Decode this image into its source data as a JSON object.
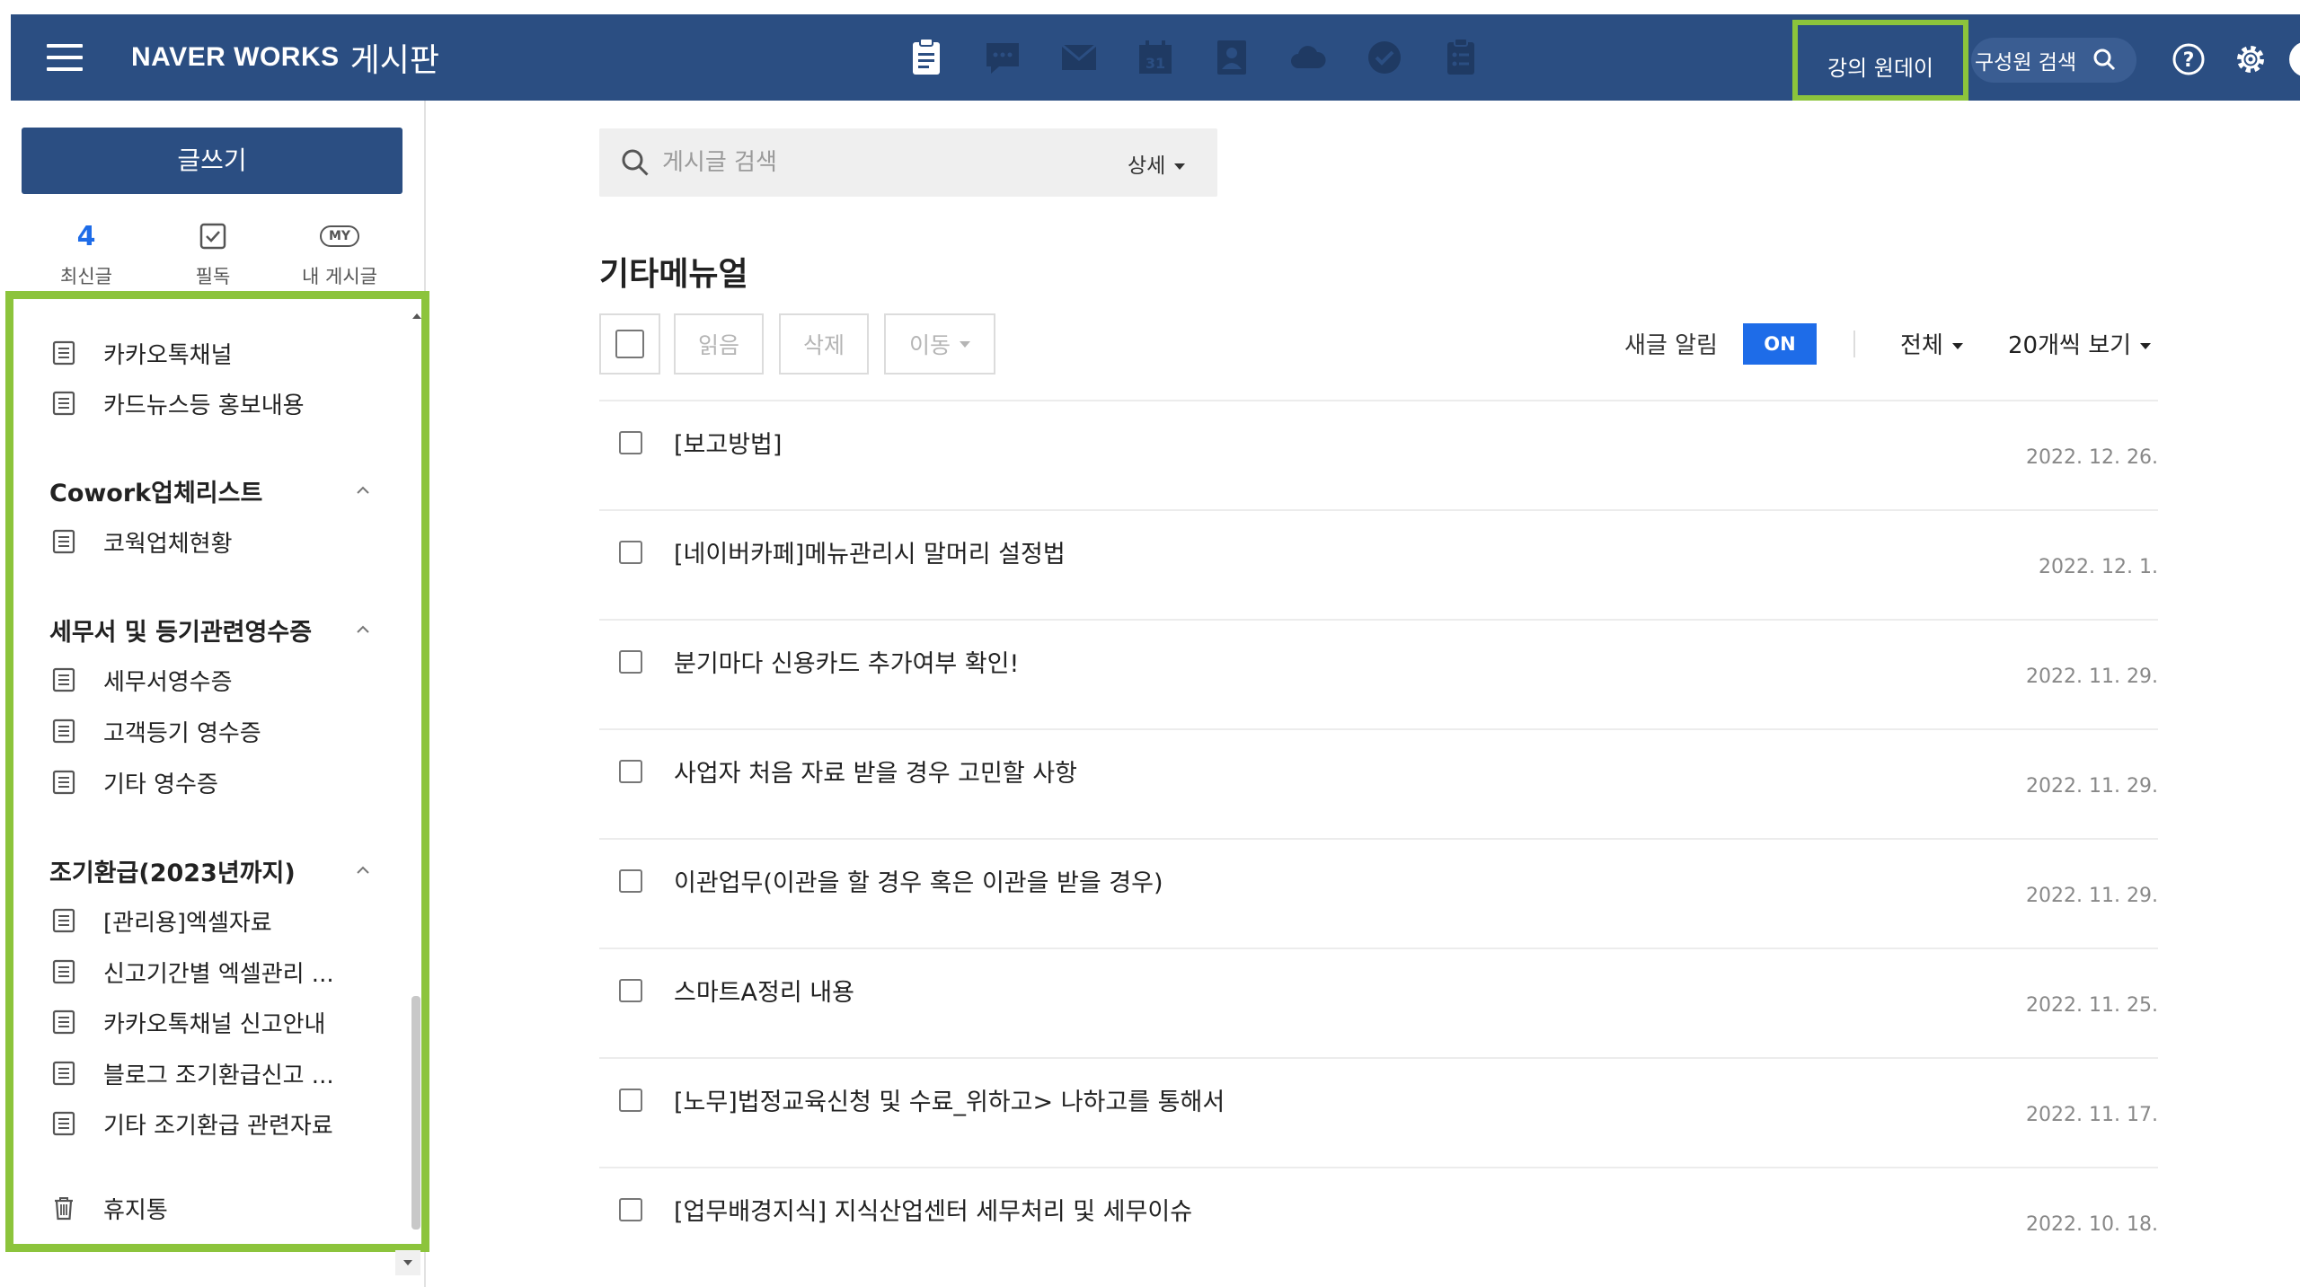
{
  "header": {
    "logo_text": "NAVER WORKS",
    "service_name": "게시판",
    "app_icons": [
      "board-icon",
      "message-icon",
      "mail-icon",
      "calendar-icon",
      "contacts-icon",
      "drive-icon",
      "task-icon",
      "form-icon"
    ],
    "calendar_day": "31",
    "highlight_label": "강의 원데이",
    "member_search_label": "구성원 검색",
    "colors": {
      "bar": "#2b4e82",
      "highlight": "#8cc43c",
      "accent": "#1e6ce8"
    }
  },
  "sidebar": {
    "write_button": "글쓰기",
    "quick_links": [
      {
        "value": "4",
        "label": "최신글"
      },
      {
        "icon": "check-square-icon",
        "label": "필독"
      },
      {
        "badge": "MY",
        "label": "내 게시글"
      }
    ],
    "tree": {
      "kakao_channel": "카카오톡채널",
      "card_news": "카드뉴스등 홍보내용",
      "group_cowork": "Cowork업체리스트",
      "cowork_status": "코웍업체현황",
      "group_tax": "세무서 및 등기관련영수증",
      "tax_office_receipt": "세무서영수증",
      "customer_registry_receipt": "고객등기 영수증",
      "other_receipt": "기타 영수증",
      "group_refund": "조기환급(2023년까지)",
      "admin_excel": "[관리용]엑셀자료",
      "period_excel": "신고기간별 엑셀관리 ...",
      "kakao_report_guide": "카카오톡채널 신고안내",
      "blog_refund": "블로그 조기환급신고 ...",
      "other_refund": "기타 조기환급 관련자료",
      "trash": "휴지통"
    }
  },
  "main": {
    "search_placeholder": "게시글 검색",
    "detail_label": "상세",
    "board_title": "기타메뉴얼",
    "toolbar": {
      "read": "읽음",
      "delete": "삭제",
      "move": "이동"
    },
    "notify_label": "새글 알림",
    "notify_state": "ON",
    "filter_label": "전체",
    "page_size_label": "20개씩 보기",
    "posts": [
      {
        "title": "[보고방법]",
        "date": "2022. 12. 26."
      },
      {
        "title": "[네이버카페]메뉴관리시 말머리 설정법",
        "date": "2022. 12. 1."
      },
      {
        "title": "분기마다 신용카드 추가여부 확인!",
        "date": "2022. 11. 29."
      },
      {
        "title": "사업자 처음 자료 받을 경우 고민할 사항",
        "date": "2022. 11. 29."
      },
      {
        "title": "이관업무(이관을 할 경우 혹은 이관을 받을 경우)",
        "date": "2022. 11. 29."
      },
      {
        "title": "스마트A정리 내용",
        "date": "2022. 11. 25."
      },
      {
        "title": "[노무]법정교육신청 및 수료_위하고> 나하고를 통해서",
        "date": "2022. 11. 17."
      },
      {
        "title": "[업무배경지식] 지식산업센터 세무처리 및 세무이슈",
        "date": "2022. 10. 18."
      }
    ]
  }
}
